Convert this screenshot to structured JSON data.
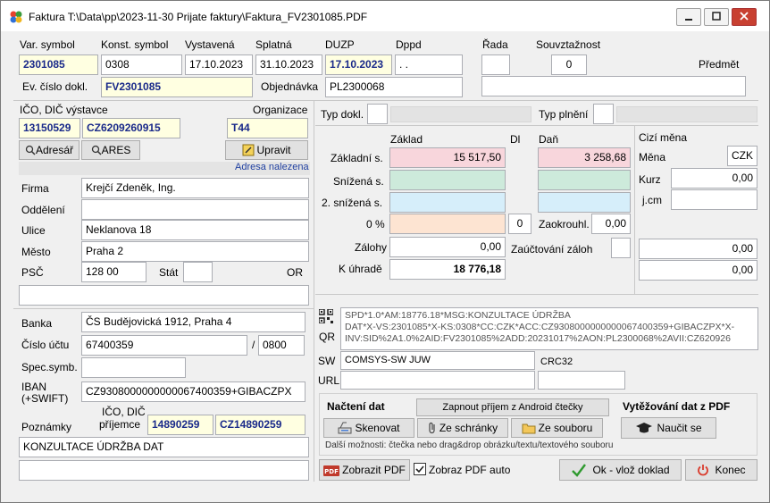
{
  "window": {
    "title": "Faktura T:\\Data\\pp\\2023-11-30 Prijate faktury\\Faktura_FV2301085.PDF"
  },
  "header": {
    "var_symbol_label": "Var. symbol",
    "var_symbol": "2301085",
    "konst_symbol_label": "Konst. symbol",
    "konst_symbol": "0308",
    "vystavena_label": "Vystavená",
    "vystavena": "17.10.2023",
    "splatna_label": "Splatná",
    "splatna": "31.10.2023",
    "duzp_label": "DUZP",
    "duzp": "17.10.2023",
    "dppd_label": "Dppd",
    "dppd": ". .",
    "rada_label": "Řada",
    "rada": "",
    "souvztaznost_label": "Souvztažnost",
    "souvztaznost": "0",
    "predmet_label": "Předmět",
    "predmet": "",
    "ev_cislo_label": "Ev. číslo dokl.",
    "ev_cislo": "FV2301085",
    "objednavka_label": "Objednávka",
    "objednavka": "PL2300068"
  },
  "supplier": {
    "ico_dic_label": "IČO, DIČ výstavce",
    "organizace_label": "Organizace",
    "ico": "13150529",
    "dic": "CZ6209260915",
    "organizace": "T44",
    "adresar_label": "Adresář",
    "ares_label": "ARES",
    "upravit_label": "Upravit",
    "adresa_status": "Adresa nalezena",
    "firma_label": "Firma",
    "firma": "Krejčí Zdeněk, Ing.",
    "oddeleni_label": "Oddělení",
    "oddeleni": "",
    "ulice_label": "Ulice",
    "ulice": "Neklanova 18",
    "mesto_label": "Město",
    "mesto": "Praha 2",
    "psc_label": "PSČ",
    "psc": "128 00",
    "stat_label": "Stát",
    "stat": "",
    "or_label": "OR",
    "or_value": ""
  },
  "bank": {
    "banka_label": "Banka",
    "banka": "ČS Budějovická 1912, Praha 4",
    "cislo_uctu_label": "Číslo účtu",
    "cislo_uctu": "67400359",
    "slash": "/",
    "kod_banky": "0800",
    "spec_symb_label": "Spec.symb.",
    "spec_symb": "",
    "iban_label": "IBAN",
    "iban_label2": "(+SWIFT)",
    "iban": "CZ9308000000000067400359+GIBACZPX",
    "poznamky_label": "Poznámky",
    "ico_dic_prijemce_label": "IČO, DIČ",
    "ico_dic_prijemce_label2": "příjemce",
    "ico_prijemce": "14890259",
    "dic_prijemce": "CZ14890259",
    "poznamky": "KONZULTACE  ÚDRŽBA DAT",
    "poznamky2": ""
  },
  "amounts": {
    "typ_dokl_label": "Typ dokl.",
    "typ_dokl": "",
    "typ_plneni_label": "Typ plnění",
    "typ_plneni": "",
    "zaklad_header": "Základ",
    "dl_header": "Dl",
    "dan_header": "Daň",
    "zakladni_label": "Základní s.",
    "zakladni_zaklad": "15 517,50",
    "zakladni_dan": "3 258,68",
    "snizena_label": "Snížená s.",
    "snizena_zaklad": "",
    "snizena_dan": "",
    "snizena2_label": "2. snížená s.",
    "snizena2_zaklad": "",
    "snizena2_dan": "",
    "nula_label": "0 %",
    "nula_zaklad": "",
    "nula_dl": "0",
    "zaokrouhl_label": "Zaokrouhl.",
    "zaokrouhl": "0,00",
    "zalohy_label": "Zálohy",
    "zalohy": "0,00",
    "zauctovani_label": "Zaúčtování záloh",
    "zauctovani": "",
    "k_uhrade_label": "K úhradě",
    "k_uhrade": "18 776,18"
  },
  "foreign": {
    "cizi_mena_label": "Cizí měna",
    "mena_label": "Měna",
    "mena": "CZK",
    "kurz_label": "Kurz",
    "kurz": "0,00",
    "jcm_label": "j.cm",
    "jcm": "",
    "zalohy_cm": "0,00",
    "k_uhrade_cm": "0,00"
  },
  "qr": {
    "qr_label": "QR",
    "lines": [
      "SPD*1.0*AM:18776.18*MSG:KONZULTACE  ÚDRŽBA",
      "DAT*X-VS:2301085*X-KS:0308*CC:CZK*ACC:CZ9308000000000067400359+GIBACZPX*X-",
      "INV:SID%2A1.0%2AID:FV2301085%2ADD:20231017%2AON:PL2300068%2AVII:CZ620926"
    ],
    "sw_label": "SW",
    "sw": "COMSYS-SW JUW",
    "crc_label": "CRC32",
    "crc": "",
    "url_label": "URL",
    "url": "",
    "url2": ""
  },
  "load": {
    "nacteni_label": "Načtení dat",
    "android_label": "Zapnout příjem z Android čtečky",
    "skenovat_label": "Skenovat",
    "schranky_label": "Ze schránky",
    "souboru_label": "Ze souboru",
    "vytezovani_label": "Vytěžování dat z PDF",
    "naucit_label": "Naučit se",
    "hint": "Další možnosti: čtečka nebo drag&drop obrázku/textu/textového souboru"
  },
  "footer": {
    "zobrazit_pdf_label": "Zobrazit PDF",
    "zobraz_auto_label": "Zobraz PDF auto",
    "ok_label": "Ok - vlož doklad",
    "konec_label": "Konec"
  },
  "colors": {
    "accent_blue": "#1a2a8a",
    "ok_check": "#2f9a2f",
    "konec_power": "#d93a2b",
    "status_link": "#1f3fa0"
  }
}
